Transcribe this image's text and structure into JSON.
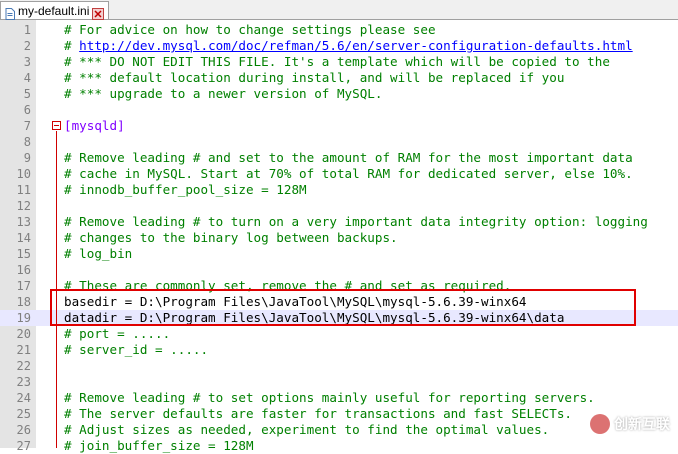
{
  "tab": {
    "label": "my-default.ini"
  },
  "colors": {
    "comment": "#008000",
    "section": "#8000ff",
    "highlight": "#e00000",
    "link": "#0000ff"
  },
  "lines": [
    {
      "n": "1",
      "text": "# For advice on how to change settings please see",
      "kind": "comment"
    },
    {
      "n": "2",
      "text": "# ",
      "link": "http://dev.mysql.com/doc/refman/5.6/en/server-configuration-defaults.html",
      "kind": "link"
    },
    {
      "n": "3",
      "text": "# *** DO NOT EDIT THIS FILE. It's a template which will be copied to the",
      "kind": "comment"
    },
    {
      "n": "4",
      "text": "# *** default location during install, and will be replaced if you",
      "kind": "comment"
    },
    {
      "n": "5",
      "text": "# *** upgrade to a newer version of MySQL.",
      "kind": "comment"
    },
    {
      "n": "6",
      "text": "",
      "kind": "plain"
    },
    {
      "n": "7",
      "text": "[mysqld]",
      "kind": "section"
    },
    {
      "n": "8",
      "text": "",
      "kind": "plain"
    },
    {
      "n": "9",
      "text": "# Remove leading # and set to the amount of RAM for the most important data",
      "kind": "comment"
    },
    {
      "n": "10",
      "text": "# cache in MySQL. Start at 70% of total RAM for dedicated server, else 10%.",
      "kind": "comment"
    },
    {
      "n": "11",
      "text": "# innodb_buffer_pool_size = 128M",
      "kind": "comment"
    },
    {
      "n": "12",
      "text": "",
      "kind": "plain"
    },
    {
      "n": "13",
      "text": "# Remove leading # to turn on a very important data integrity option: logging",
      "kind": "comment"
    },
    {
      "n": "14",
      "text": "# changes to the binary log between backups.",
      "kind": "comment"
    },
    {
      "n": "15",
      "text": "# log_bin",
      "kind": "comment"
    },
    {
      "n": "16",
      "text": "",
      "kind": "plain"
    },
    {
      "n": "17",
      "text": "# These are commonly set, remove the # and set as required.",
      "kind": "comment"
    },
    {
      "n": "18",
      "text": "basedir = D:\\Program Files\\JavaTool\\MySQL\\mysql-5.6.39-winx64",
      "kind": "plain"
    },
    {
      "n": "19",
      "text": "datadir = D:\\Program Files\\JavaTool\\MySQL\\mysql-5.6.39-winx64\\data",
      "kind": "plain",
      "current": true
    },
    {
      "n": "20",
      "text": "# port = .....",
      "kind": "comment"
    },
    {
      "n": "21",
      "text": "# server_id = .....",
      "kind": "comment"
    },
    {
      "n": "22",
      "text": "",
      "kind": "plain"
    },
    {
      "n": "23",
      "text": "",
      "kind": "plain"
    },
    {
      "n": "24",
      "text": "# Remove leading # to set options mainly useful for reporting servers.",
      "kind": "comment"
    },
    {
      "n": "25",
      "text": "# The server defaults are faster for transactions and fast SELECTs.",
      "kind": "comment"
    },
    {
      "n": "26",
      "text": "# Adjust sizes as needed, experiment to find the optimal values.",
      "kind": "comment"
    },
    {
      "n": "27",
      "text": "# join_buffer_size = 128M",
      "kind": "comment"
    }
  ],
  "watermark": {
    "text": "创新互联"
  }
}
